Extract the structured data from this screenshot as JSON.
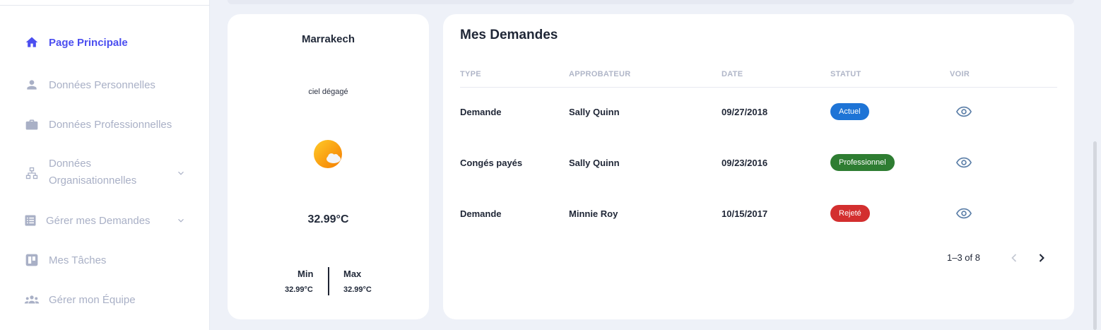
{
  "sidebar": {
    "items": [
      {
        "label": "Page Principale",
        "icon": "home-icon",
        "active": true
      },
      {
        "label": "Données Personnelles",
        "icon": "person-icon"
      },
      {
        "label": "Données Professionnelles",
        "icon": "briefcase-icon"
      },
      {
        "label": "Données Organisationnelles",
        "line1": "Données",
        "line2": "Organisationnelles",
        "icon": "org-chart-icon",
        "expandable": true
      },
      {
        "label": "Gérer mes Demandes",
        "icon": "list-icon",
        "expandable": true
      },
      {
        "label": "Mes Tâches",
        "icon": "board-icon"
      },
      {
        "label": "Gérer mon Équipe",
        "icon": "team-icon"
      }
    ]
  },
  "weather": {
    "city": "Marrakech",
    "description": "ciel dégagé",
    "icon": "sun-cloud-icon",
    "temperature": "32.99°C",
    "min_label": "Min",
    "min_value": "32.99°C",
    "max_label": "Max",
    "max_value": "32.99°C"
  },
  "requests": {
    "title": "Mes Demandes",
    "columns": [
      "TYPE",
      "APPROBATEUR",
      "DATE",
      "STATUT",
      "VOIR"
    ],
    "rows": [
      {
        "type": "Demande",
        "approver": "Sally Quinn",
        "date": "09/27/2018",
        "status": "Actuel",
        "status_color": "#1e74d6"
      },
      {
        "type": "Congés payés",
        "approver": "Sally Quinn",
        "date": "09/23/2016",
        "status": "Professionnel",
        "status_color": "#2e7d32"
      },
      {
        "type": "Demande",
        "approver": "Minnie Roy",
        "date": "10/15/2017",
        "status": "Rejeté",
        "status_color": "#d32f2f"
      }
    ],
    "pagination": "1–3 of 8"
  },
  "colors": {
    "accent": "#4b4ef0",
    "muted": "#a9b0c6",
    "eye": "#5c7fa8"
  }
}
